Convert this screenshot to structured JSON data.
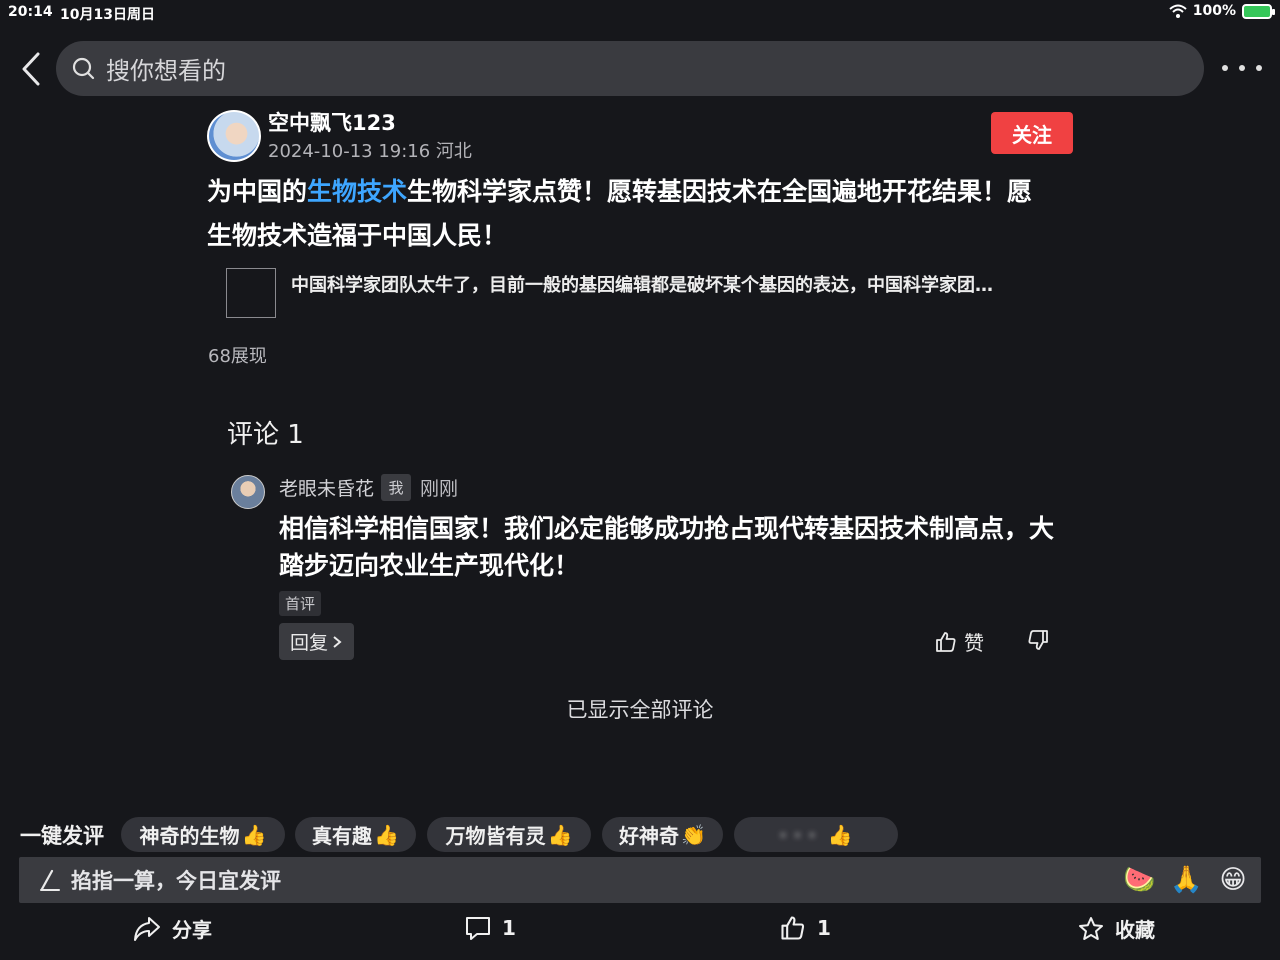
{
  "status_bar": {
    "time": "20:14",
    "date": "10月13日周日",
    "battery": "100%"
  },
  "search": {
    "placeholder": "搜你想看的"
  },
  "post": {
    "author": "空中飘飞123",
    "meta": "2024-10-13 19:16  河北",
    "follow_label": "关注",
    "text_before": "为中国的",
    "link": "生物技术",
    "text_after": "生物科学家点赞！愿转基因技术在全国遍地开花结果！愿生物技术造福于中国人民！",
    "quote": "中国科学家团队太牛了，目前一般的基因编辑都是破坏某个基因的表达，中国科学家团…",
    "views": "68展现"
  },
  "comments": {
    "title": "评论 1",
    "items": [
      {
        "name": "老眼未昏花",
        "me_badge": "我",
        "time": "刚刚",
        "text": "相信科学相信国家！我们必定能够成功抢占现代转基因技术制高点，大踏步迈向农业生产现代化！",
        "tag": "首评",
        "reply_label": "回复",
        "like_label": "赞"
      }
    ],
    "end_text": "已显示全部评论"
  },
  "quick_comment": {
    "label": "一键发评",
    "chips": [
      {
        "text": "神奇的生物",
        "emoji": "👍"
      },
      {
        "text": "真有趣",
        "emoji": "👍"
      },
      {
        "text": "万物皆有灵",
        "emoji": "👍"
      },
      {
        "text": "好神奇",
        "emoji": "👏"
      },
      {
        "text": "·  ·  ·",
        "emoji": "👍"
      }
    ]
  },
  "input": {
    "placeholder": "掐指一算，今日宜发评"
  },
  "emoji_buttons": [
    "🍉",
    "🙏",
    "😁"
  ],
  "toolbar": {
    "share": "分享",
    "comment_count": "1",
    "like_count": "1",
    "favorite": "收藏"
  },
  "colors": {
    "accent_link": "#3ea6ff",
    "follow_red": "#f04142",
    "background": "#16171b"
  }
}
